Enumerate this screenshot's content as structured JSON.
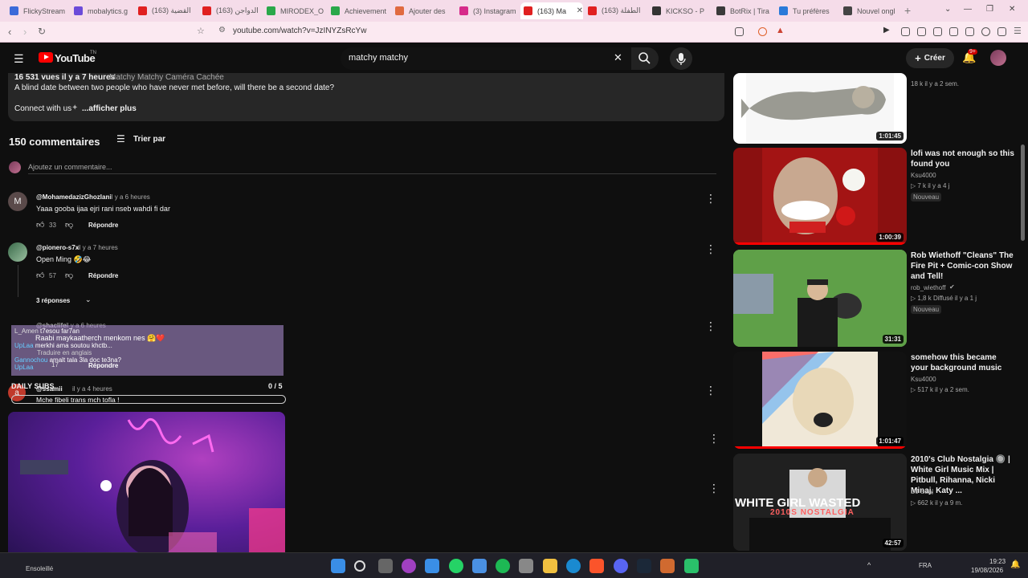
{
  "tabs": [
    {
      "label": "FlickyStream",
      "color": "#3b6ad9"
    },
    {
      "label": "mobalytics.g",
      "color": "#6b4bd9"
    },
    {
      "label": "(163) القضية",
      "color": "#e02020"
    },
    {
      "label": "(163) الدواجن",
      "color": "#e02020"
    },
    {
      "label": "MIRODEX_O",
      "color": "#2aa84a"
    },
    {
      "label": "Achievement",
      "color": "#2aa84a"
    },
    {
      "label": "Ajouter des",
      "color": "#e06a40"
    },
    {
      "label": "(3) Instagram",
      "color": "#d62a8a"
    },
    {
      "label": "(163) Ma",
      "color": "#e02020"
    },
    {
      "label": "(163) الطفلة",
      "color": "#e02020"
    },
    {
      "label": "KICKSO - P",
      "color": "#333333"
    },
    {
      "label": "BotRix | Tira",
      "color": "#3a3a3a"
    },
    {
      "label": "Tu préfères",
      "color": "#2a7ad9"
    },
    {
      "label": "Nouvel ongl",
      "color": "#444444"
    }
  ],
  "browser": {
    "url": "youtube.com/watch?v=JzINYZsRcYw"
  },
  "header": {
    "logo": "YouTube",
    "logo_suffix": "TN",
    "search_value": "matchy matchy",
    "create_label": "Créer",
    "notif_count": "9+"
  },
  "description": {
    "meta": "16 531 vues  il y a 7 heures",
    "tags": "Matchy Matchy Caméra Cachée",
    "text": "A blind date between two people who have never met before, will there be a second date?",
    "connect": "Connect with us",
    "more": "...afficher plus"
  },
  "comments_header": {
    "count": "150 commentaires",
    "sort": "Trier par",
    "add_placeholder": "Ajoutez un commentaire..."
  },
  "comments": [
    {
      "author": "@MohamedazizGhozlani",
      "time": "il y a 6 heures",
      "text": "Yaaa gooba ijaa ejri rani nseb wahdi fi dar",
      "likes": "33",
      "reply": "Répondre",
      "avatar_letter": "M"
    },
    {
      "author": "@pionero-s7x",
      "time": "il y a 7 heures",
      "text": "Open Ming 🤣😂",
      "likes": "57",
      "reply": "Répondre",
      "replies": "3 réponses"
    },
    {
      "author": "@shaclife",
      "time": "il y a 6 heures",
      "text": "",
      "likes": "17",
      "reply": "Répondre",
      "translate": "Traduire en anglais"
    },
    {
      "author": "@ssamii",
      "time": "il y a 4 heures",
      "text": "Mche fibeli trans mch tofla !",
      "avatar_letter": "a"
    }
  ],
  "chat": [
    {
      "user": "L_Amen",
      "msg": "t7esou far7an"
    },
    {
      "user": "",
      "msg": "Raabi maykaatherch menkom nes 🤗❤️"
    },
    {
      "user": "UpLaa",
      "msg": "merkhi ama soutou khctb..."
    },
    {
      "user": "Gannochou",
      "msg": "amalt tala 3la doc te3na?"
    },
    {
      "user": "UpLaa",
      "msg": ""
    }
  ],
  "daily_subs": {
    "label": "DAILY SUBS",
    "value": "0 / 5"
  },
  "sidebar": [
    {
      "title": "",
      "meta": "18 k  il y a 2 sem.",
      "duration": "1:01:45"
    },
    {
      "title": "lofi was not enough so this found you",
      "channel": "Ksu4000",
      "meta": "▷ 7 k  il y a 4 j",
      "badge": "Nouveau",
      "duration": "1:00:39"
    },
    {
      "title": "Rob Wiethoff \"Cleans\" The Fire Pit + Comic-con Show and Tell!",
      "channel": "rob_wiethoff",
      "meta": "▷ 1,8 k  Diffusé il y a 1 j",
      "badge": "Nouveau",
      "duration": "31:31"
    },
    {
      "title": "somehow this became your background music",
      "channel": "Ksu4000",
      "meta": "▷ 517 k  il y a 2 sem.",
      "duration": "1:01:47"
    },
    {
      "title": "2010's Club Nostalgia 🔘 | White Girl Music Mix | Pitbull, Rihanna, Nicki Minaj, Katy ...",
      "channel": "DJ Saal",
      "meta": "▷ 662 k  il y a 9 m.",
      "duration": "42:57",
      "overlay": "WHITE GIRL WASTED",
      "overlay2": "2010S NOSTALGIA"
    }
  ],
  "taskbar": {
    "lang": "FRA",
    "time": "19:23",
    "date": "19/08/2026",
    "left_label": "Ensoleillé"
  }
}
